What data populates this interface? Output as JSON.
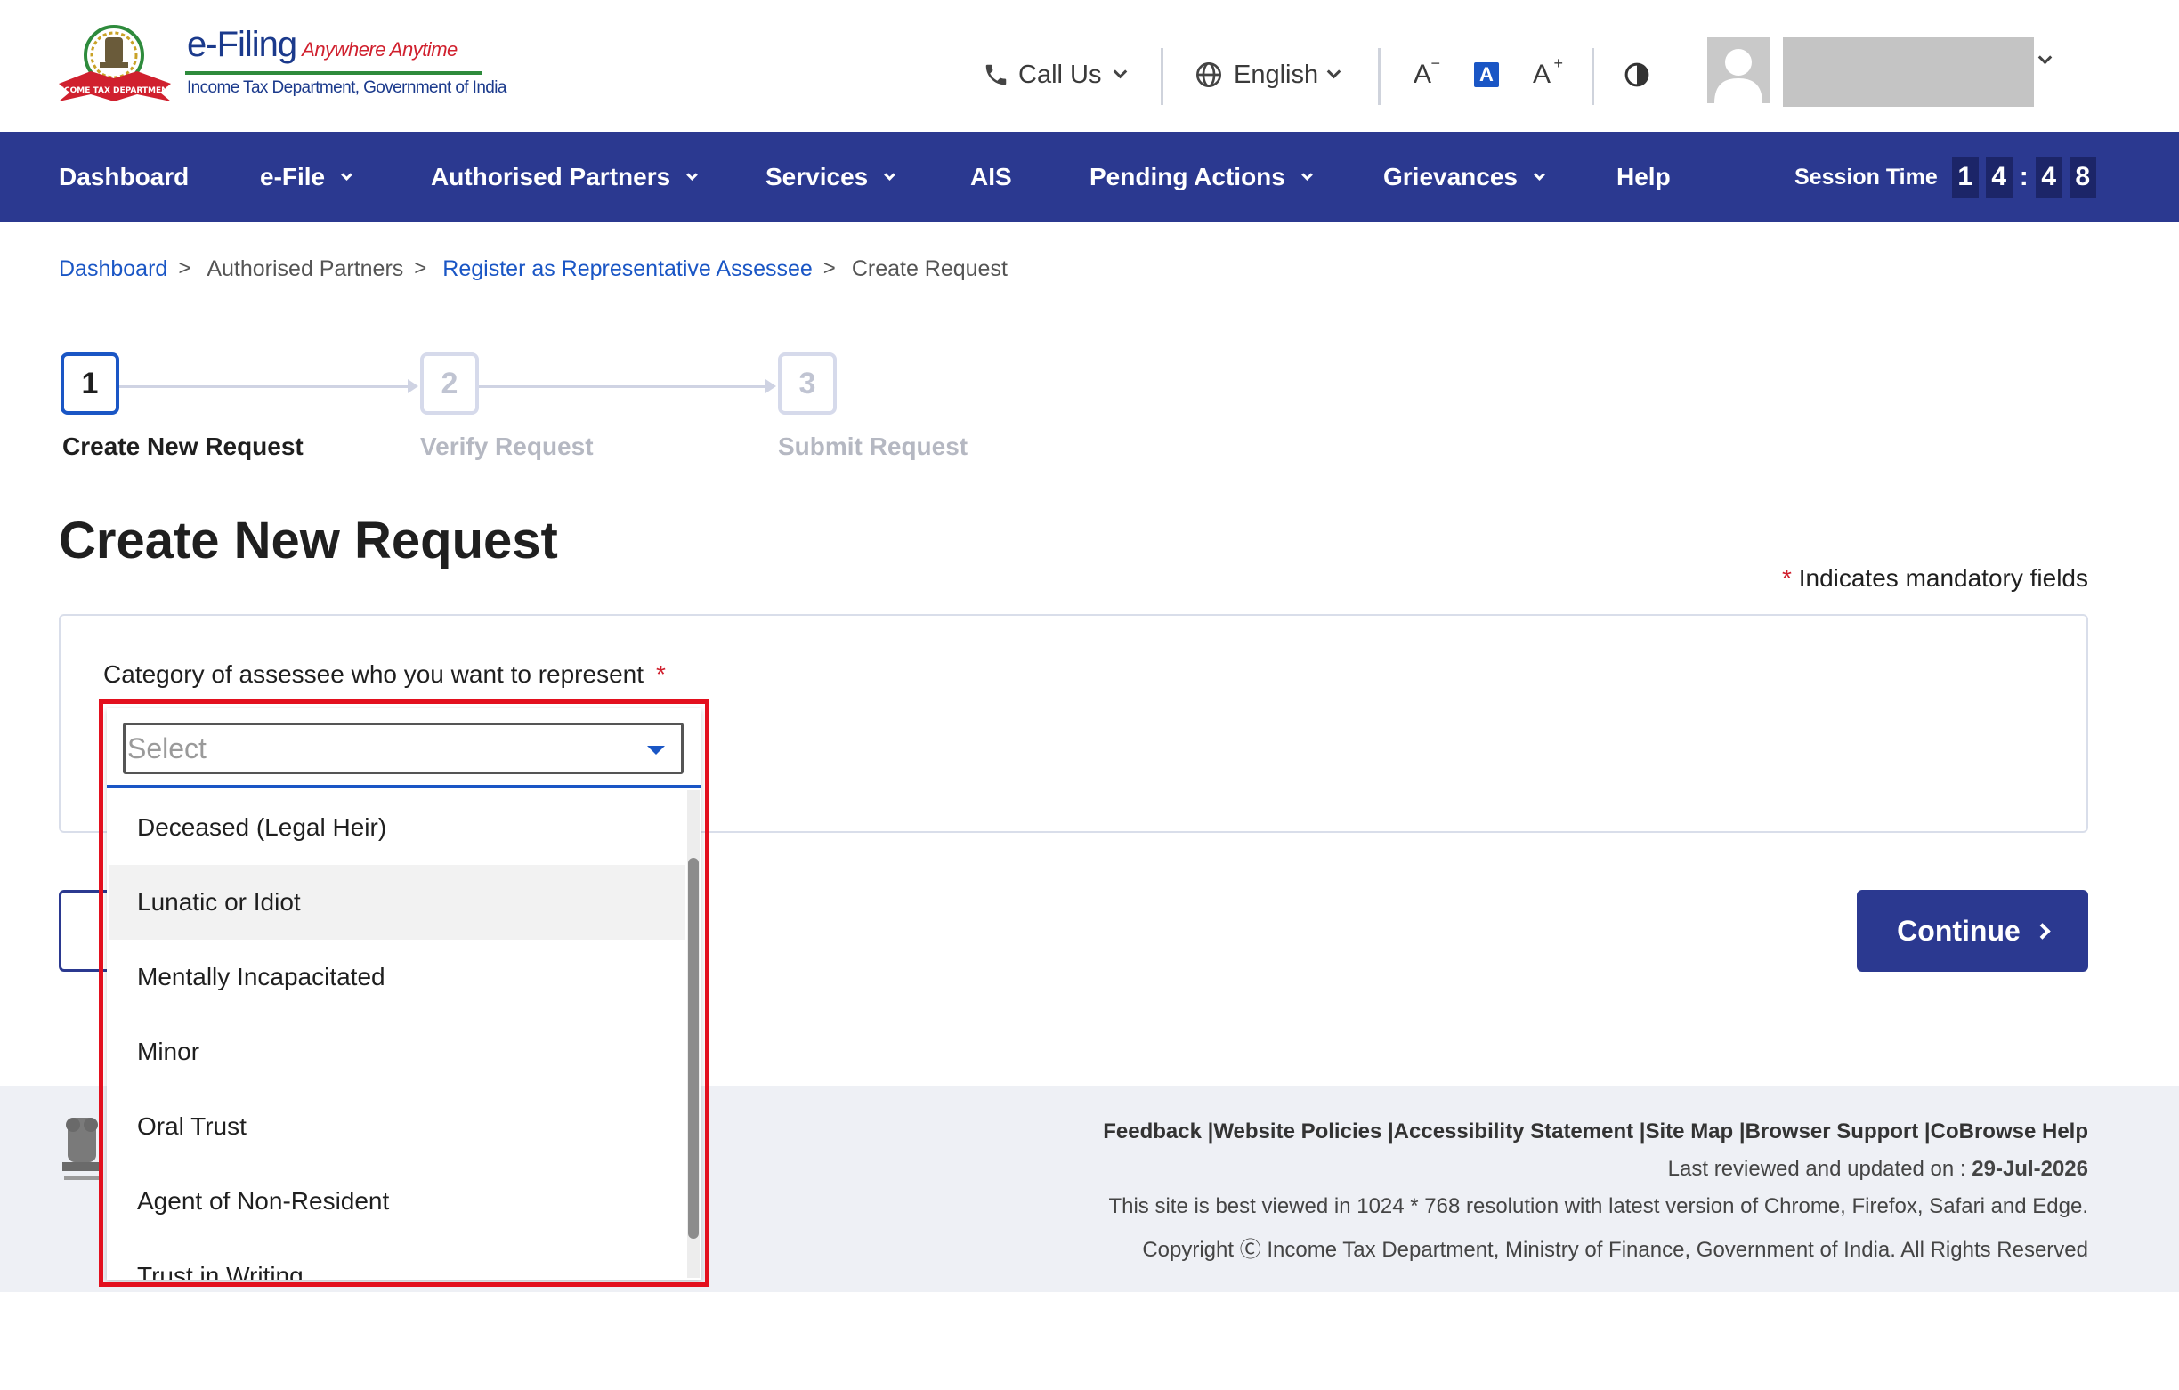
{
  "header": {
    "logo": {
      "title": "e-Filing",
      "tagline": "Anywhere Anytime",
      "subtitle": "Income Tax Department, Government of India",
      "emblem_text": "INCOME TAX DEPARTMENT"
    },
    "call_us": "Call Us",
    "language": "English",
    "font_decrease_label": "A",
    "font_normal_label": "A",
    "font_increase_label": "A",
    "user_name": ""
  },
  "nav": {
    "items": [
      {
        "label": "Dashboard",
        "has_dropdown": false
      },
      {
        "label": "e-File",
        "has_dropdown": true
      },
      {
        "label": "Authorised Partners",
        "has_dropdown": true
      },
      {
        "label": "Services",
        "has_dropdown": true
      },
      {
        "label": "AIS",
        "has_dropdown": false
      },
      {
        "label": "Pending Actions",
        "has_dropdown": true
      },
      {
        "label": "Grievances",
        "has_dropdown": true
      },
      {
        "label": "Help",
        "has_dropdown": false
      }
    ],
    "session_label": "Session Time",
    "session_digits": [
      "1",
      "4",
      "4",
      "8"
    ],
    "session_separator": ":"
  },
  "breadcrumb": [
    {
      "label": "Dashboard",
      "link": true
    },
    {
      "label": "Authorised Partners",
      "link": false
    },
    {
      "label": "Register as Representative Assessee",
      "link": true
    },
    {
      "label": "Create Request",
      "link": false
    }
  ],
  "breadcrumb_separator": ">",
  "stepper": [
    {
      "number": "1",
      "label": "Create New Request",
      "active": true
    },
    {
      "number": "2",
      "label": "Verify Request",
      "active": false
    },
    {
      "number": "3",
      "label": "Submit Request",
      "active": false
    }
  ],
  "main": {
    "title": "Create New Request",
    "mandatory_star": "*",
    "mandatory_note": "Indicates mandatory fields",
    "field_label": "Category of assessee who you want to represent",
    "field_required_star": "*",
    "select_placeholder": "Select",
    "dropdown_options": [
      "Deceased (Legal Heir)",
      "Lunatic or Idiot",
      "Mentally Incapacitated",
      "Minor",
      "Oral Trust",
      "Agent of Non-Resident",
      "Trust in Writing"
    ],
    "hovered_option_index": 1,
    "continue_label": "Continue"
  },
  "footer": {
    "links_text": "Feedback |Website Policies |Accessibility Statement |Site Map |Browser Support |CoBrowse Help",
    "last_reviewed_label": "Last reviewed and updated on : ",
    "last_reviewed_date": "29-Jul-2026",
    "resolution_note": "This site is best viewed in 1024 * 768 resolution with latest version of Chrome, Firefox, Safari and Edge.",
    "copyright": "Copyright Ⓒ Income Tax Department, Ministry of Finance, Government of India. All Rights Reserved"
  },
  "colors": {
    "nav_bg": "#2b3990",
    "link": "#1a56c5",
    "required": "#d0202e",
    "highlight_border": "#e3101e",
    "footer_bg": "#eef0f5"
  }
}
